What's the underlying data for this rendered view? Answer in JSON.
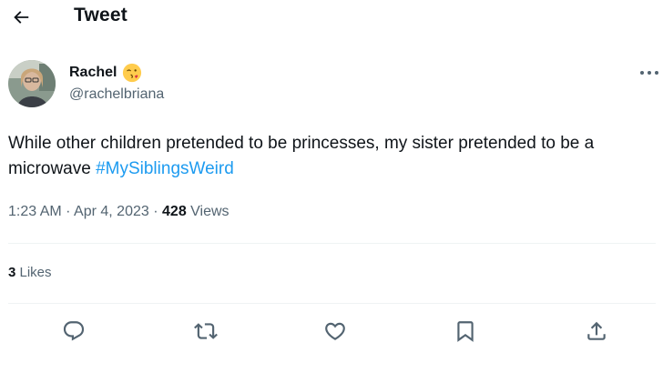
{
  "header": {
    "title": "Tweet",
    "back_icon": "arrow-left-icon"
  },
  "author": {
    "display_name": "Rachel",
    "emoji": "kissing-face-emoji",
    "handle": "@rachelbriana"
  },
  "tweet": {
    "text": "While other children pretended to be princesses, my sister pretended to be a microwave ",
    "hashtag": "#MySiblingsWeird"
  },
  "meta": {
    "time": "1:23 AM",
    "separator": "·",
    "date": "Apr 4, 2023",
    "views_count": "428",
    "views_label": " Views"
  },
  "engagement": {
    "likes_count": "3",
    "likes_label": " Likes"
  },
  "actions": [
    "reply-icon",
    "retweet-icon",
    "like-icon",
    "bookmark-icon",
    "share-icon"
  ],
  "colors": {
    "text": "#0f1419",
    "secondary": "#536471",
    "accent": "#1d9bf0",
    "divider": "#eff3f4"
  }
}
